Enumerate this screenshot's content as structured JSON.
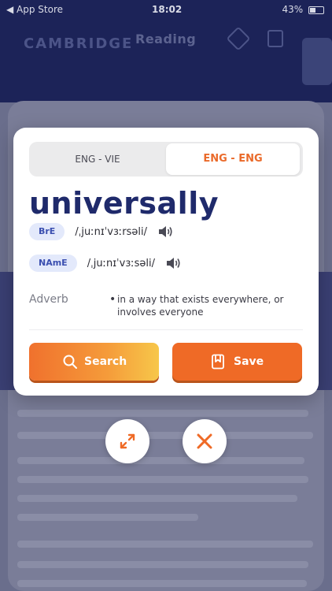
{
  "status_bar": {
    "carrier": "◀ App Store",
    "time": "18:02",
    "battery": "43%"
  },
  "background": {
    "title": "Reading",
    "logo": "CAMBRIDGE"
  },
  "dictionary": {
    "tabs": [
      {
        "label": "ENG - VIE",
        "selected": false
      },
      {
        "label": "ENG - ENG",
        "selected": true
      }
    ],
    "word": "universally",
    "pronunciations": [
      {
        "region": "BrE",
        "ipa": "/ˌjuːnɪˈvɜːrsəli/",
        "icon": "speaker-icon"
      },
      {
        "region": "NAmE",
        "ipa": "/ˌjuːnɪˈvɜːsəli/",
        "icon": "speaker-icon"
      }
    ],
    "part_of_speech": "Adverb",
    "definition": "in a way that exists everywhere, or involves everyone",
    "actions": {
      "search_label": "Search",
      "save_label": "Save"
    }
  },
  "floating": {
    "expand_icon": "expand-icon",
    "close_icon": "close-icon"
  },
  "colors": {
    "accent": "#ef6a26",
    "word": "#1f2a6b",
    "badge_bg": "#e3e9fb"
  }
}
